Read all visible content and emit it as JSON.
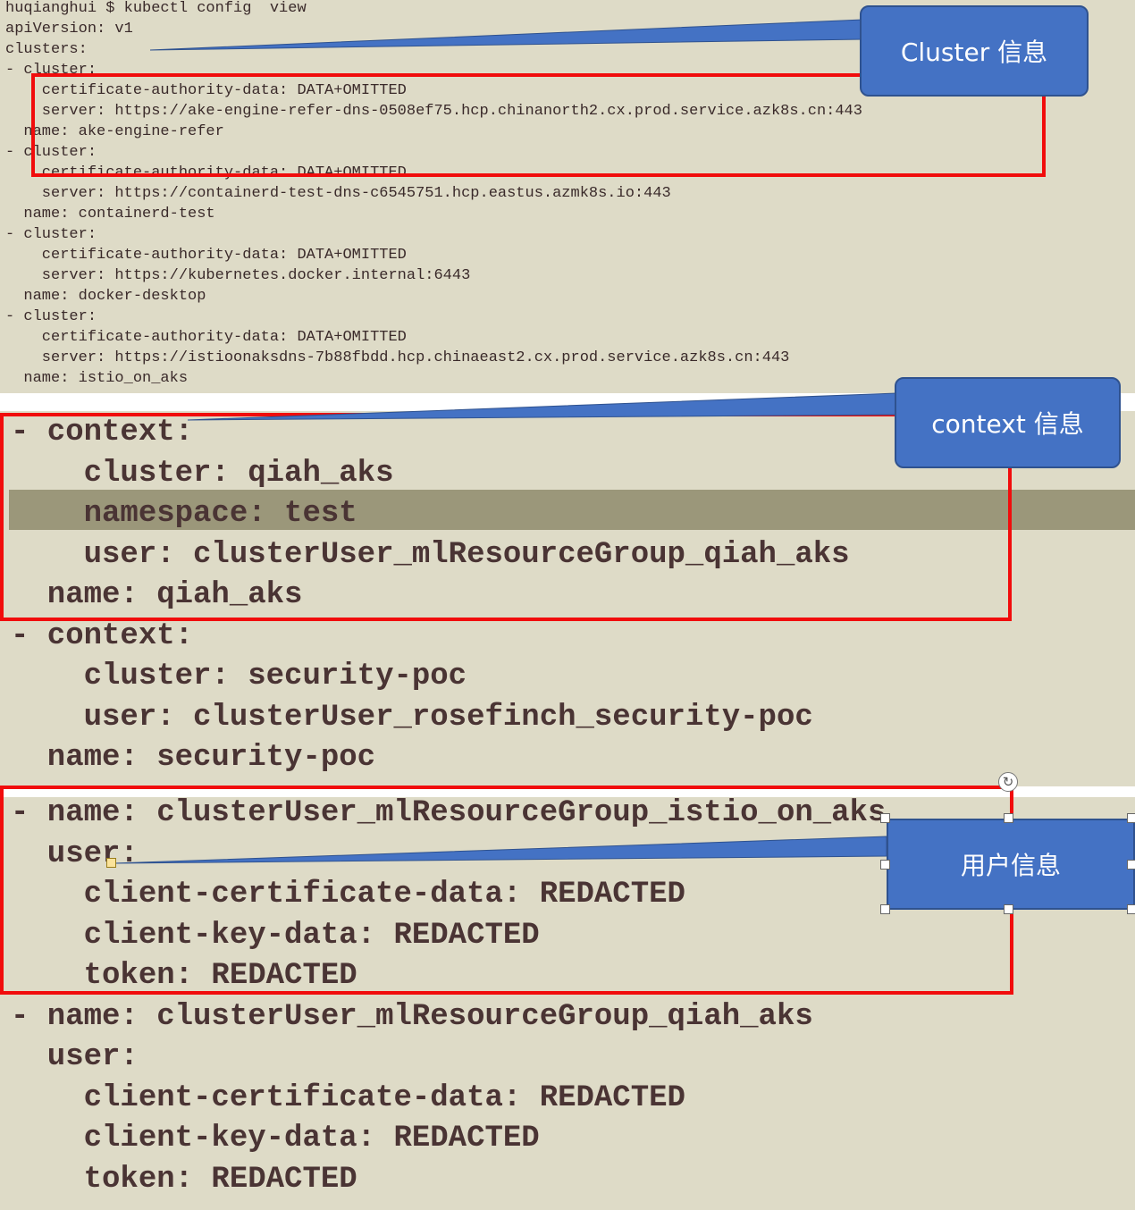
{
  "top_terminal": {
    "lines": [
      "huqianghui $ kubectl config  view",
      "apiVersion: v1",
      "clusters:",
      "- cluster:",
      "    certificate-authority-data: DATA+OMITTED",
      "    server: https://ake-engine-refer-dns-0508ef75.hcp.chinanorth2.cx.prod.service.azk8s.cn:443",
      "  name: ake-engine-refer",
      "- cluster:",
      "    certificate-authority-data: DATA+OMITTED",
      "    server: https://containerd-test-dns-c6545751.hcp.eastus.azmk8s.io:443",
      "  name: containerd-test",
      "- cluster:",
      "    certificate-authority-data: DATA+OMITTED",
      "    server: https://kubernetes.docker.internal:6443",
      "  name: docker-desktop",
      "- cluster:",
      "    certificate-authority-data: DATA+OMITTED",
      "    server: https://istioonaksdns-7b88fbdd.hcp.chinaeast2.cx.prod.service.azk8s.cn:443",
      "  name: istio_on_aks"
    ]
  },
  "context_section": {
    "lines": [
      "- context:",
      "    cluster: qiah_aks",
      "    namespace: test",
      "    user: clusterUser_mlResourceGroup_qiah_aks",
      "  name: qiah_aks",
      "- context:",
      "    cluster: security-poc",
      "    user: clusterUser_rosefinch_security-poc",
      "  name: security-poc"
    ]
  },
  "user_section": {
    "lines": [
      "- name: clusterUser_mlResourceGroup_istio_on_aks",
      "  user:",
      "    client-certificate-data: REDACTED",
      "    client-key-data: REDACTED",
      "    token: REDACTED",
      "- name: clusterUser_mlResourceGroup_qiah_aks",
      "  user:",
      "    client-certificate-data: REDACTED",
      "    client-key-data: REDACTED",
      "    token: REDACTED"
    ]
  },
  "callouts": {
    "cluster": "Cluster 信息",
    "context": "context 信息",
    "user": "用户信息"
  },
  "colors": {
    "terminal_bg": "#dedbc7",
    "highlight_row": "#9b977a",
    "red_box": "#f10c0c",
    "callout_fill": "#4472c4"
  },
  "icons": {
    "rotate": "rotate-handle-icon"
  }
}
